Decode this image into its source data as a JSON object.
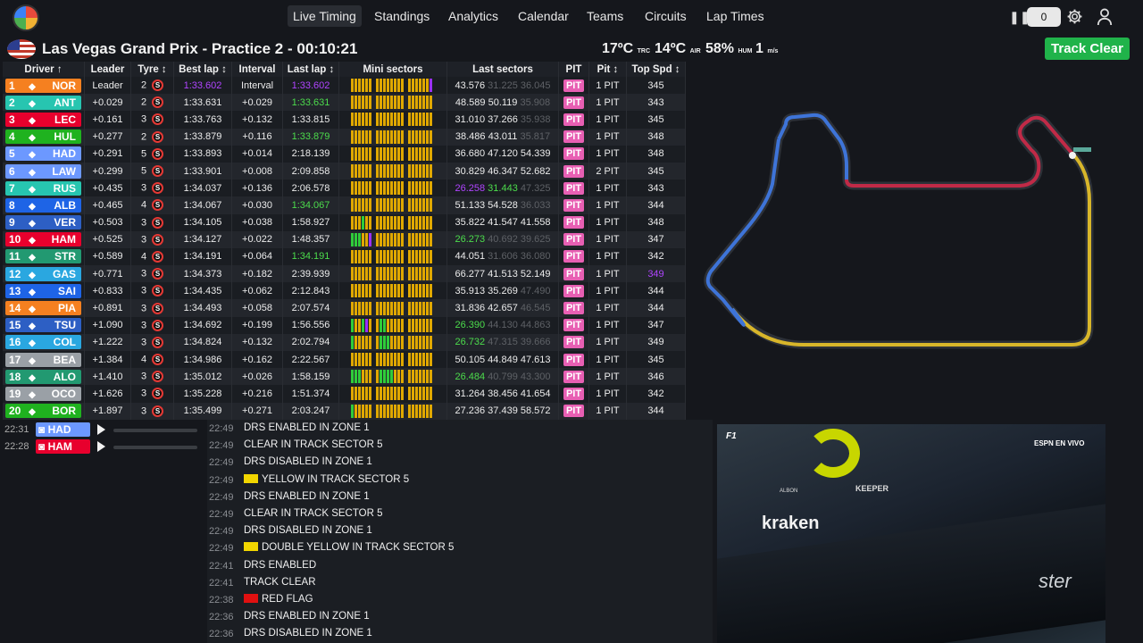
{
  "nav": {
    "items": [
      "Live Timing",
      "Standings",
      "Analytics",
      "Calendar",
      "Teams",
      "Circuits",
      "Lap Times"
    ],
    "counter": "0"
  },
  "session": {
    "title": "Las Vegas Grand Prix - Practice 2",
    "clock": "- 00:10:21",
    "track_temp": "17ºC",
    "track_label": "TRC",
    "air_temp": "14ºC",
    "air_label": "AIR",
    "humidity": "58%",
    "hum_label": "HUM",
    "wind": "1",
    "wind_unit": "m/s",
    "status": "Track Clear"
  },
  "columns": [
    "Driver ↑",
    "Leader",
    "Tyre ↕",
    "Best lap ↕",
    "Interval",
    "Last lap ↕",
    "Mini sectors",
    "Last sectors",
    "PIT",
    "Pit ↕",
    "Top Spd ↕"
  ],
  "drivers": [
    {
      "pos": "1",
      "code": "NOR",
      "color": "#f58020",
      "gap": "Leader",
      "tyre": "2",
      "best": "1:33.602",
      "best_c": "purple",
      "int": "Interval",
      "last": "1:33.602",
      "last_c": "purple",
      "s1": "43.576",
      "s1c": "",
      "s2": "31.225",
      "s2c": "grey",
      "s3": "36.045",
      "s3c": "grey",
      "pits": "1 PIT",
      "spd": "345",
      "spdc": "",
      "ms": "yyyyyy|yyyyyyyy|yyyyyyp"
    },
    {
      "pos": "2",
      "code": "ANT",
      "color": "#27c5b0",
      "gap": "+0.029",
      "tyre": "2",
      "best": "1:33.631",
      "best_c": "",
      "int": "+0.029",
      "last": "1:33.631",
      "last_c": "green",
      "s1": "48.589",
      "s1c": "",
      "s2": "50.119",
      "s2c": "",
      "s3": "35.908",
      "s3c": "grey",
      "pits": "1 PIT",
      "spd": "343",
      "spdc": "",
      "ms": "yyyyyy|yyyyyyyy|yyyyyyy"
    },
    {
      "pos": "3",
      "code": "LEC",
      "color": "#e8002d",
      "gap": "+0.161",
      "tyre": "3",
      "best": "1:33.763",
      "best_c": "",
      "int": "+0.132",
      "last": "1:33.815",
      "last_c": "",
      "s1": "31.010",
      "s1c": "",
      "s2": "37.266",
      "s2c": "",
      "s3": "35.938",
      "s3c": "grey",
      "pits": "1 PIT",
      "spd": "345",
      "spdc": "",
      "ms": "yyyyyy|yyyyyyyy|yyyyyyy"
    },
    {
      "pos": "4",
      "code": "HUL",
      "color": "#1fb21f",
      "gap": "+0.277",
      "tyre": "2",
      "best": "1:33.879",
      "best_c": "",
      "int": "+0.116",
      "last": "1:33.879",
      "last_c": "green",
      "s1": "38.486",
      "s1c": "",
      "s2": "43.011",
      "s2c": "",
      "s3": "35.817",
      "s3c": "grey",
      "pits": "1 PIT",
      "spd": "348",
      "spdc": "",
      "ms": "yyyyyy|yyyyyyyy|yyyyyyy"
    },
    {
      "pos": "5",
      "code": "HAD",
      "color": "#6c98ff",
      "gap": "+0.291",
      "tyre": "5",
      "best": "1:33.893",
      "best_c": "",
      "int": "+0.014",
      "last": "2:18.139",
      "last_c": "",
      "s1": "36.680",
      "s1c": "",
      "s2": "47.120",
      "s2c": "",
      "s3": "54.339",
      "s3c": "",
      "pits": "1 PIT",
      "spd": "348",
      "spdc": "",
      "ms": "yyyyyy|yyyyyyyy|yyyyyyy"
    },
    {
      "pos": "6",
      "code": "LAW",
      "color": "#6c98ff",
      "gap": "+0.299",
      "tyre": "5",
      "best": "1:33.901",
      "best_c": "",
      "int": "+0.008",
      "last": "2:09.858",
      "last_c": "",
      "s1": "30.829",
      "s1c": "",
      "s2": "46.347",
      "s2c": "",
      "s3": "52.682",
      "s3c": "",
      "pits": "2 PIT",
      "spd": "345",
      "spdc": "",
      "ms": "yyyyyy|yyyyyyyy|yyyyyyy"
    },
    {
      "pos": "7",
      "code": "RUS",
      "color": "#27c5b0",
      "gap": "+0.435",
      "tyre": "3",
      "best": "1:34.037",
      "best_c": "",
      "int": "+0.136",
      "last": "2:06.578",
      "last_c": "",
      "s1": "26.258",
      "s1c": "purple",
      "s2": "31.443",
      "s2c": "green",
      "s3": "47.325",
      "s3c": "grey",
      "pits": "1 PIT",
      "spd": "343",
      "spdc": "",
      "ms": "yyyyyy|yyyyyyyy|yyyyyyy"
    },
    {
      "pos": "8",
      "code": "ALB",
      "color": "#1e64e6",
      "gap": "+0.465",
      "tyre": "4",
      "best": "1:34.067",
      "best_c": "",
      "int": "+0.030",
      "last": "1:34.067",
      "last_c": "green",
      "s1": "51.133",
      "s1c": "",
      "s2": "54.528",
      "s2c": "",
      "s3": "36.033",
      "s3c": "grey",
      "pits": "1 PIT",
      "spd": "344",
      "spdc": "",
      "ms": "yyyyyy|yyyyyyyy|yyyyyyy"
    },
    {
      "pos": "9",
      "code": "VER",
      "color": "#2d5fc4",
      "gap": "+0.503",
      "tyre": "3",
      "best": "1:34.105",
      "best_c": "",
      "int": "+0.038",
      "last": "1:58.927",
      "last_c": "",
      "s1": "35.822",
      "s1c": "",
      "s2": "41.547",
      "s2c": "",
      "s3": "41.558",
      "s3c": "",
      "pits": "1 PIT",
      "spd": "348",
      "spdc": "",
      "ms": "yyygyy|yyyyyyyy|yyyyyyy"
    },
    {
      "pos": "10",
      "code": "HAM",
      "color": "#e8002d",
      "gap": "+0.525",
      "tyre": "3",
      "best": "1:34.127",
      "best_c": "",
      "int": "+0.022",
      "last": "1:48.357",
      "last_c": "",
      "s1": "26.273",
      "s1c": "green",
      "s2": "40.692",
      "s2c": "grey",
      "s3": "39.625",
      "s3c": "grey",
      "pits": "1 PIT",
      "spd": "347",
      "spdc": "",
      "ms": "gggyyp|yyyyyyyy|yyyyyyy"
    },
    {
      "pos": "11",
      "code": "STR",
      "color": "#229971",
      "gap": "+0.589",
      "tyre": "4",
      "best": "1:34.191",
      "best_c": "",
      "int": "+0.064",
      "last": "1:34.191",
      "last_c": "green",
      "s1": "44.051",
      "s1c": "",
      "s2": "31.606",
      "s2c": "grey",
      "s3": "36.080",
      "s3c": "grey",
      "pits": "1 PIT",
      "spd": "342",
      "spdc": "",
      "ms": "yyyyyy|yyyyyyyy|yyyyyyy"
    },
    {
      "pos": "12",
      "code": "GAS",
      "color": "#2aa7e0",
      "gap": "+0.771",
      "tyre": "3",
      "best": "1:34.373",
      "best_c": "",
      "int": "+0.182",
      "last": "2:39.939",
      "last_c": "",
      "s1": "66.277",
      "s1c": "",
      "s2": "41.513",
      "s2c": "",
      "s3": "52.149",
      "s3c": "",
      "pits": "1 PIT",
      "spd": "349",
      "spdc": "purple",
      "ms": "yyyyyy|yyyyyyyy|yyyyyyy"
    },
    {
      "pos": "13",
      "code": "SAI",
      "color": "#1e64e6",
      "gap": "+0.833",
      "tyre": "3",
      "best": "1:34.435",
      "best_c": "",
      "int": "+0.062",
      "last": "2:12.843",
      "last_c": "",
      "s1": "35.913",
      "s1c": "",
      "s2": "35.269",
      "s2c": "",
      "s3": "47.490",
      "s3c": "grey",
      "pits": "1 PIT",
      "spd": "344",
      "spdc": "",
      "ms": "yyyyyy|yyyyyyyy|yyyyyyy"
    },
    {
      "pos": "14",
      "code": "PIA",
      "color": "#f58020",
      "gap": "+0.891",
      "tyre": "3",
      "best": "1:34.493",
      "best_c": "",
      "int": "+0.058",
      "last": "2:07.574",
      "last_c": "",
      "s1": "31.836",
      "s1c": "",
      "s2": "42.657",
      "s2c": "",
      "s3": "46.545",
      "s3c": "grey",
      "pits": "1 PIT",
      "spd": "344",
      "spdc": "",
      "ms": "yyyyyy|yyyyyyyy|yyyyyyy"
    },
    {
      "pos": "15",
      "code": "TSU",
      "color": "#2d5fc4",
      "gap": "+1.090",
      "tyre": "3",
      "best": "1:34.692",
      "best_c": "",
      "int": "+0.199",
      "last": "1:56.556",
      "last_c": "",
      "s1": "26.390",
      "s1c": "green",
      "s2": "44.130",
      "s2c": "grey",
      "s3": "44.863",
      "s3c": "grey",
      "pits": "1 PIT",
      "spd": "347",
      "spdc": "",
      "ms": "gyygpy|yggyyyyy|yyyyyyy"
    },
    {
      "pos": "16",
      "code": "COL",
      "color": "#2aa7e0",
      "gap": "+1.222",
      "tyre": "3",
      "best": "1:34.824",
      "best_c": "",
      "int": "+0.132",
      "last": "2:02.794",
      "last_c": "",
      "s1": "26.732",
      "s1c": "green",
      "s2": "47.315",
      "s2c": "grey",
      "s3": "39.666",
      "s3c": "grey",
      "pits": "1 PIT",
      "spd": "349",
      "spdc": "",
      "ms": "gyyyyy|ygggyyyy|yyyyyyy"
    },
    {
      "pos": "17",
      "code": "BEA",
      "color": "#9aa0a6",
      "gap": "+1.384",
      "tyre": "4",
      "best": "1:34.986",
      "best_c": "",
      "int": "+0.162",
      "last": "2:22.567",
      "last_c": "",
      "s1": "50.105",
      "s1c": "",
      "s2": "44.849",
      "s2c": "",
      "s3": "47.613",
      "s3c": "",
      "pits": "1 PIT",
      "spd": "345",
      "spdc": "",
      "ms": "yyyyyy|yyyyyyyy|yyyyyyy"
    },
    {
      "pos": "18",
      "code": "ALO",
      "color": "#229971",
      "gap": "+1.410",
      "tyre": "3",
      "best": "1:35.012",
      "best_c": "",
      "int": "+0.026",
      "last": "1:58.159",
      "last_c": "",
      "s1": "26.484",
      "s1c": "green",
      "s2": "40.799",
      "s2c": "grey",
      "s3": "43.300",
      "s3c": "grey",
      "pits": "1 PIT",
      "spd": "346",
      "spdc": "",
      "ms": "gggyyy|yggggyyy|yyyyyyy"
    },
    {
      "pos": "19",
      "code": "OCO",
      "color": "#9aa0a6",
      "gap": "+1.626",
      "tyre": "3",
      "best": "1:35.228",
      "best_c": "",
      "int": "+0.216",
      "last": "1:51.374",
      "last_c": "",
      "s1": "31.264",
      "s1c": "",
      "s2": "38.456",
      "s2c": "",
      "s3": "41.654",
      "s3c": "",
      "pits": "1 PIT",
      "spd": "342",
      "spdc": "",
      "ms": "yyyyyy|yyyyyyyy|yyyyyyy"
    },
    {
      "pos": "20",
      "code": "BOR",
      "color": "#1fb21f",
      "gap": "+1.897",
      "tyre": "3",
      "best": "1:35.499",
      "best_c": "",
      "int": "+0.271",
      "last": "2:03.247",
      "last_c": "",
      "s1": "27.236",
      "s1c": "",
      "s2": "37.439",
      "s2c": "",
      "s3": "58.572",
      "s3c": "",
      "pits": "1 PIT",
      "spd": "344",
      "spdc": "",
      "ms": "gyyyyy|yyyyyyyy|yyyyyyy"
    }
  ],
  "pit_label": "PIT",
  "radio": [
    {
      "time": "22:31",
      "code": "HAD",
      "color": "#6c98ff"
    },
    {
      "time": "22:28",
      "code": "HAM",
      "color": "#e8002d"
    }
  ],
  "race_control": [
    {
      "time": "22:49",
      "msg": "DRS ENABLED IN ZONE 1",
      "flag": ""
    },
    {
      "time": "22:49",
      "msg": "CLEAR IN TRACK SECTOR 5",
      "flag": ""
    },
    {
      "time": "22:49",
      "msg": "DRS DISABLED IN ZONE 1",
      "flag": ""
    },
    {
      "time": "22:49",
      "msg": "YELLOW IN TRACK SECTOR 5",
      "flag": "#f2d600"
    },
    {
      "time": "22:49",
      "msg": "DRS ENABLED IN ZONE 1",
      "flag": ""
    },
    {
      "time": "22:49",
      "msg": "CLEAR IN TRACK SECTOR 5",
      "flag": ""
    },
    {
      "time": "22:49",
      "msg": "DRS DISABLED IN ZONE 1",
      "flag": ""
    },
    {
      "time": "22:49",
      "msg": "DOUBLE YELLOW IN TRACK SECTOR 5",
      "flag": "#f2d600"
    },
    {
      "time": "22:41",
      "msg": "DRS ENABLED",
      "flag": ""
    },
    {
      "time": "22:41",
      "msg": "TRACK CLEAR",
      "flag": ""
    },
    {
      "time": "22:38",
      "msg": "RED FLAG",
      "flag": "#e01010"
    },
    {
      "time": "22:36",
      "msg": "DRS ENABLED IN ZONE 1",
      "flag": ""
    },
    {
      "time": "22:36",
      "msg": "DRS DISABLED IN ZONE 1",
      "flag": ""
    }
  ],
  "video": {
    "sponsor": "kraken",
    "sponsor2": "KEEPER",
    "driver_name": "ALBON",
    "broadcaster": "ESPN EN VIVO",
    "tail_text": "ster"
  },
  "colors": {
    "accent_green": "#20b34a",
    "purple": "#b044ff",
    "pit_pink": "#e85fb3",
    "sector_yellow": "#e0a800"
  }
}
